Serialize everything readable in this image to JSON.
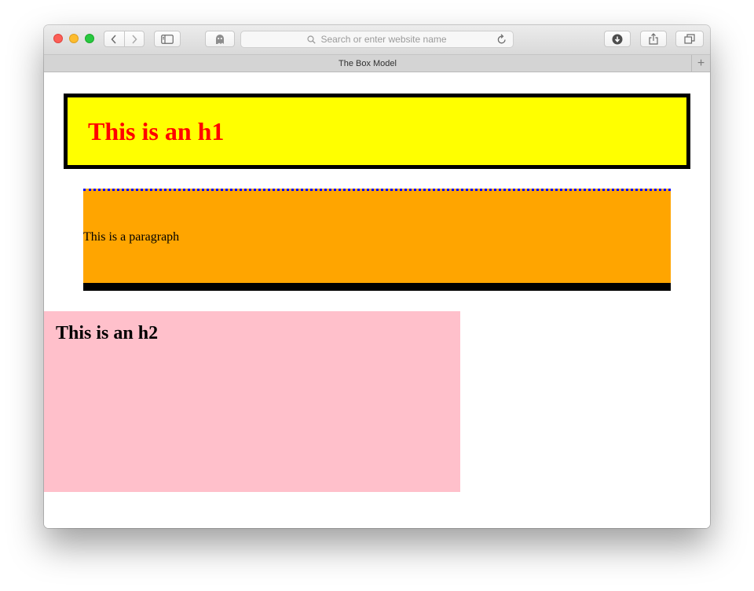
{
  "browser": {
    "address_bar": {
      "placeholder": "Search or enter website name"
    },
    "tab": {
      "title": "The Box Model"
    }
  },
  "page": {
    "h1": "This is an h1",
    "paragraph": "This is a paragraph",
    "h2": "This is an h2"
  },
  "colors": {
    "h1_background": "#ffff00",
    "h1_text": "#ff0000",
    "paragraph_background": "#ffa500",
    "paragraph_top_border": "#0000ff",
    "h2_background": "#ffc0cb"
  }
}
